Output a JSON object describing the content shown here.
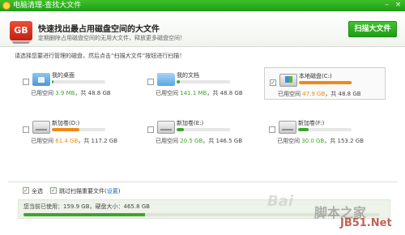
{
  "window": {
    "title": "电脑清理-查找大文件",
    "min_glyph": "–",
    "close_glyph": "×"
  },
  "header": {
    "icon_text": "GB",
    "title": "快速找出最占用磁盘空间的大文件",
    "subtitle": "定期删除占用磁盘空间的无用大文件，释放更多磁盘空间！",
    "scan_button": "扫描大文件"
  },
  "hint": "请选择您要进行管理的磁盘，然后点击“扫描大文件”按钮进行扫描！",
  "used_label": "已用空间",
  "total_sep": "，共",
  "disks": [
    {
      "name": "我的桌面",
      "used": "3.9 MB",
      "total": "48.8 GB",
      "fill_fraction": 0.03,
      "color": "#3aa72b",
      "icon": "home-folder-icon",
      "checked": false
    },
    {
      "name": "我的文档",
      "used": "141.1 MB",
      "total": "48.8 GB",
      "fill_fraction": 0.06,
      "color": "#3aa72b",
      "icon": "folder-icon",
      "checked": false
    },
    {
      "name": "本地磁盘(C:)",
      "used": "47.9 GB",
      "total": "48.8 GB",
      "fill_fraction": 0.98,
      "color": "#f08a14",
      "icon": "windows-drive-icon",
      "checked": true
    },
    {
      "name": "新加卷(D:)",
      "used": "61.4 GB",
      "total": "117.2 GB",
      "fill_fraction": 0.52,
      "color": "#f08a14",
      "icon": "hard-drive-icon",
      "checked": false
    },
    {
      "name": "新加卷(E:)",
      "used": "20.5 GB",
      "total": "146.5 GB",
      "fill_fraction": 0.14,
      "color": "#3aa72b",
      "icon": "hard-drive-icon",
      "checked": false
    },
    {
      "name": "新加卷(F:)",
      "used": "30.0 GB",
      "total": "153.2 GB",
      "fill_fraction": 0.2,
      "color": "#3aa72b",
      "icon": "hard-drive-icon",
      "checked": false
    }
  ],
  "footer": {
    "select_all": "全选",
    "skip_important": "跳过扫描重要文件(",
    "settings_link": "设置",
    "skip_close": ")",
    "summary": "您当前已使用：159.9 GB，硬盘大小：465.8 GB",
    "summary_fill_fraction": 0.34
  },
  "watermark": {
    "text": "脚本之家",
    "url": "JB51.Net",
    "baidu": "Bai"
  },
  "colors": {
    "accent": "#3aa72b",
    "warning": "#f08a14",
    "link": "#1c6fc8"
  }
}
